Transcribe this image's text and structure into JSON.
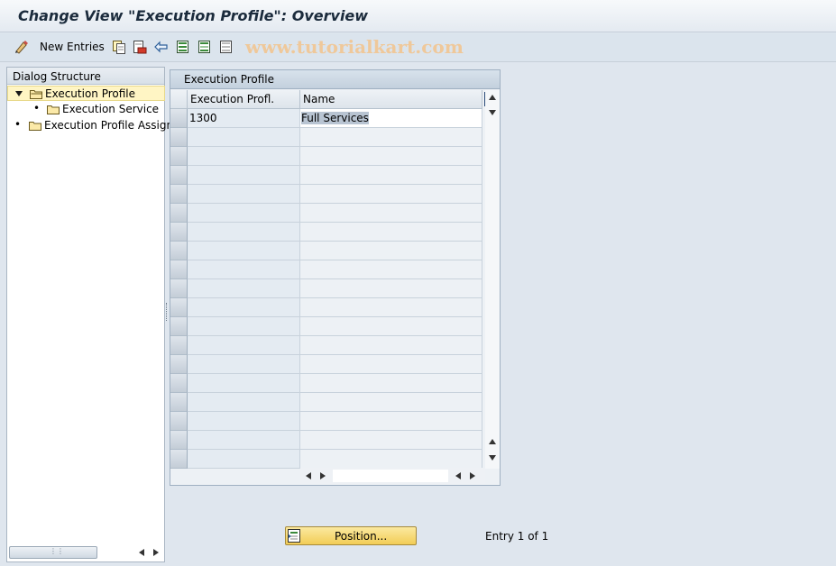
{
  "window": {
    "title": "Change View \"Execution Profile\": Overview"
  },
  "toolbar": {
    "new_entries_label": "New Entries",
    "watermark": "www.tutorialkart.com"
  },
  "dialog_structure": {
    "header": "Dialog Structure",
    "items": [
      {
        "label": "Execution Profile",
        "level": 0,
        "expanded": true,
        "selected": true
      },
      {
        "label": "Execution Service",
        "level": 1,
        "expanded": false,
        "selected": false
      },
      {
        "label": "Execution Profile Assign",
        "level": 0,
        "expanded": false,
        "selected": false
      }
    ]
  },
  "table": {
    "title": "Execution Profile",
    "columns": [
      "Execution Profl.",
      "Name"
    ],
    "rows": [
      {
        "profile": "1300",
        "name": "Full Services"
      }
    ]
  },
  "footer": {
    "position_button": "Position...",
    "entry_text": "Entry 1 of 1"
  },
  "colors": {
    "background": "#dfe6ee",
    "selection_highlight": "#fff5c4",
    "button_yellow": "#f2cd56",
    "text_selection": "#b8c4d2"
  }
}
